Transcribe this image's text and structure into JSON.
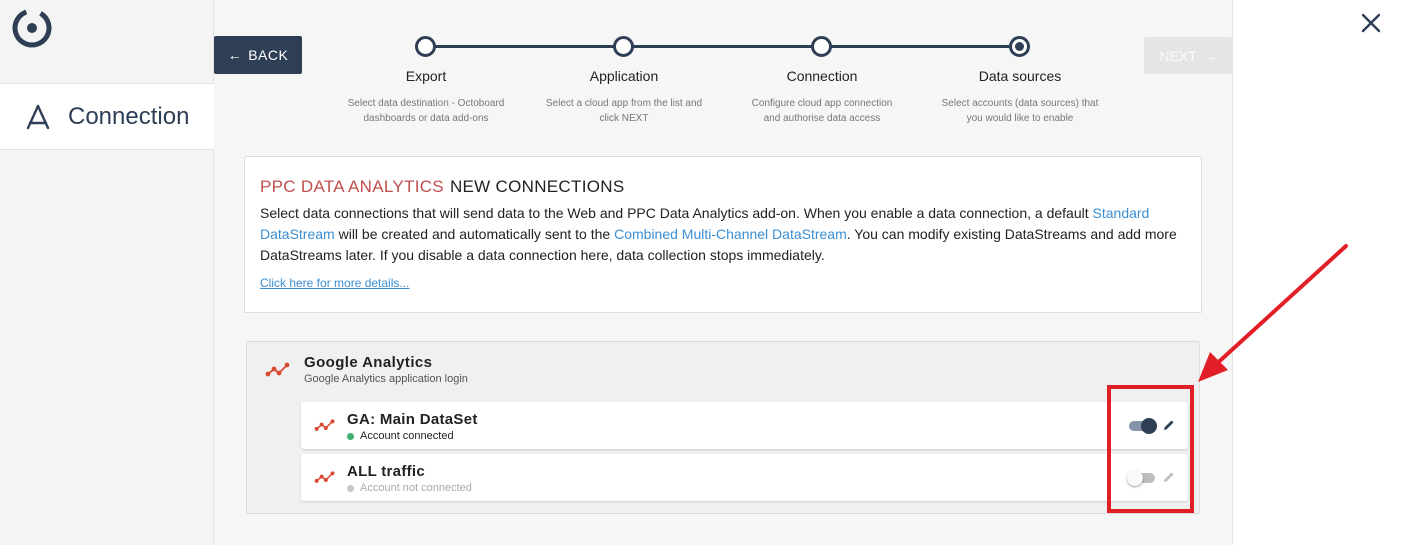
{
  "sidebar": {
    "logo_icon": "octoboard-logo-icon",
    "active_item": {
      "label": "Connection",
      "icon": "connection-icon"
    }
  },
  "toolbar": {
    "back_label": "BACK",
    "back_arrow": "←",
    "next_label": "NEXT",
    "next_arrow": "→",
    "close_icon": "close-icon"
  },
  "stepper": {
    "steps": [
      {
        "title": "Export",
        "desc": "Select data destination - Octoboard dashboards or data add-ons"
      },
      {
        "title": "Application",
        "desc": "Select a cloud app from the list and click NEXT"
      },
      {
        "title": "Connection",
        "desc": "Configure cloud app connection and authorise data access"
      },
      {
        "title": "Data sources",
        "desc": "Select accounts (data sources) that you would like to enable"
      }
    ],
    "active_step": 3
  },
  "info": {
    "brand": "PPC DATA ANALYTICS",
    "title": "NEW CONNECTIONS",
    "body_1": "Select data connections that will send data to the Web and PPC Data Analytics add-on. When you enable a data connection, a default ",
    "link_1": "Standard DataStream",
    "body_2": " will be created and automatically sent to the ",
    "link_2": "Combined Multi-Channel DataStream",
    "body_3": ". You can modify existing DataStreams and add more DataStreams later. If you disable a data connection here, data collection stops immediately.",
    "more_link": "Click here for more details..."
  },
  "connections": {
    "group_title": "Google Analytics",
    "group_sub": "Google Analytics application login",
    "group_icon": "google-analytics-icon",
    "items": [
      {
        "title": "GA: Main DataSet",
        "status": "Account connected",
        "enabled": true,
        "status_color": "#3fae6f"
      },
      {
        "title": "ALL traffic",
        "status": "Account not connected",
        "enabled": false,
        "status_color": "#c8c8c8"
      }
    ]
  },
  "colors": {
    "primary": "#2e3e55",
    "brand_red": "#c0504d",
    "link": "#3a8ed4",
    "annotation": "#e21f26"
  }
}
